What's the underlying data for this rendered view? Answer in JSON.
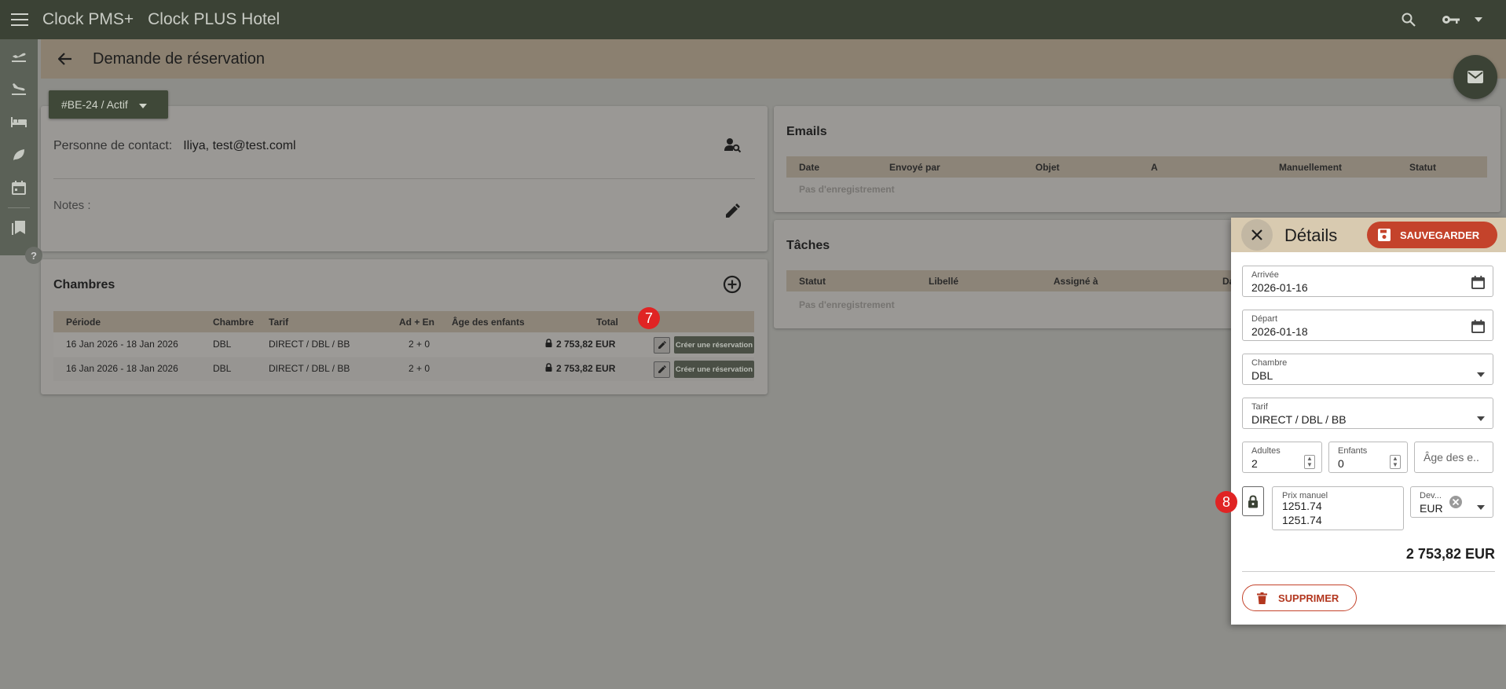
{
  "topbar": {
    "app_name": "Clock PMS+",
    "hotel_name": "Clock PLUS Hotel",
    "icons": [
      "menu-icon",
      "search-icon",
      "key-icon",
      "caret-down-icon"
    ]
  },
  "rail": {
    "items": [
      "departure-flight-icon",
      "arrival-flight-icon",
      "bed-icon",
      "leaf-icon",
      "calendar-icon",
      "bookmarks-icon"
    ],
    "help_label": "?"
  },
  "page": {
    "title": "Demande de réservation"
  },
  "status_button": {
    "label": "#BE-24 / Actif"
  },
  "contact": {
    "label": "Personne de contact:",
    "value": "Iliya, test@test.coml",
    "notes_label": "Notes :"
  },
  "rooms": {
    "title": "Chambres",
    "columns": [
      "Période",
      "Chambre",
      "Tarif",
      "Ad + En",
      "Âge des enfants",
      "Total"
    ],
    "rows": [
      {
        "period": "16 Jan 2026 - 18 Jan 2026",
        "room": "DBL",
        "rate": "DIRECT / DBL / BB",
        "guests": "2 + 0",
        "children_ages": "",
        "total": "2 753,82 EUR",
        "action": "Créer une réservation"
      },
      {
        "period": "16 Jan 2026 - 18 Jan 2026",
        "room": "DBL",
        "rate": "DIRECT / DBL / BB",
        "guests": "2 + 0",
        "children_ages": "",
        "total": "2 753,82 EUR",
        "action": "Créer une réservation"
      }
    ],
    "badge": "7"
  },
  "emails": {
    "title": "Emails",
    "columns": [
      "Date",
      "Envoyé par",
      "Objet",
      "A",
      "Manuellement",
      "Statut"
    ],
    "empty": "Pas d'enregistrement"
  },
  "tasks": {
    "title": "Tâches",
    "columns": [
      "Statut",
      "Libellé",
      "Assigné à",
      "Da"
    ],
    "empty": "Pas d'enregistrement"
  },
  "details": {
    "title": "Détails",
    "save_label": "SAUVEGARDER",
    "arrival_label": "Arrivée",
    "arrival_value": "2026-01-16",
    "departure_label": "Départ",
    "departure_value": "2026-01-18",
    "room_label": "Chambre",
    "room_value": "DBL",
    "rate_label": "Tarif",
    "rate_value": "DIRECT / DBL / BB",
    "adults_label": "Adultes",
    "adults_value": "2",
    "children_label": "Enfants",
    "children_value": "0",
    "ages_placeholder": "Âge des e...",
    "manual_price_label": "Prix manuel",
    "manual_price_line1": "1251.74",
    "manual_price_line2": "1251.74",
    "currency_label": "Dev...",
    "currency_value": "EUR",
    "total": "2 753,82 EUR",
    "delete_label": "SUPPRIMER",
    "badge": "8"
  },
  "colors": {
    "topbar": "#3b4235",
    "accent_save": "#c4432b",
    "badge": "#e02424",
    "header": "#8b8070"
  }
}
